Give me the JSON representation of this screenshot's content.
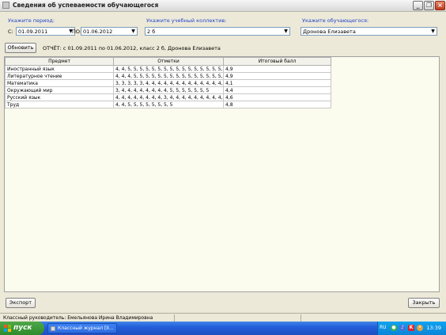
{
  "window": {
    "title": "Сведения об успеваемости обучающегося"
  },
  "period": {
    "label": "Укажите период:",
    "from_label": "С:",
    "from_value": "01.09.2011",
    "to_label": "ПО:",
    "to_value": "01.06.2012"
  },
  "collective": {
    "label": "Укажите учебный коллектив:",
    "value": "2 б"
  },
  "student": {
    "label": "Укажите обучающегося:",
    "value": "Дронова Елизавета"
  },
  "refresh_label": "Обновить",
  "report_text": "ОТЧЁТ: с 01.09.2011 по 01.06.2012, класс 2 б, Дронова Елизавета",
  "table": {
    "headers": [
      "Предмет",
      "Отметки",
      "Итоговый балл"
    ],
    "rows": [
      [
        "Иностранный язык",
        "4, 4, 5, 5, 5, 5, 5, 5, 5, 5, 5, 5, 5, 5, 5, 5, 5, 5,",
        "4,9"
      ],
      [
        "Литературное чтение",
        "4, 4, 4, 5, 5, 5, 5, 5, 5, 5, 5, 5, 5, 5, 5, 5, 5, 5,",
        "4,9"
      ],
      [
        "Математика",
        "3, 3, 3, 3, 3, 4, 4, 4, 4, 4, 4, 4, 4, 4, 4, 4, 4, 4,",
        "4,1"
      ],
      [
        "Окружающий мир",
        "3, 4, 4, 4, 4, 4, 4, 4, 4, 5, 5, 5, 5, 5, 5, 5",
        "4,4"
      ],
      [
        "Русский язык",
        "4, 4, 4, 4, 4, 4, 4, 4, 3, 4, 4, 4, 4, 4, 4, 4, 4, 4,",
        "4,6"
      ],
      [
        "Труд",
        "4, 4, 5, 5, 5, 5, 5, 5, 5, 5",
        "4,8"
      ]
    ]
  },
  "export_label": "Экспорт",
  "close_label": "Закрыть",
  "status_text": "Классный руководитель: Емельянова  Ирина  Владимировна",
  "taskbar": {
    "start_label": "пуск",
    "task_label": "Классный журнал [II...",
    "lang": "RU",
    "clock": "13:39"
  }
}
